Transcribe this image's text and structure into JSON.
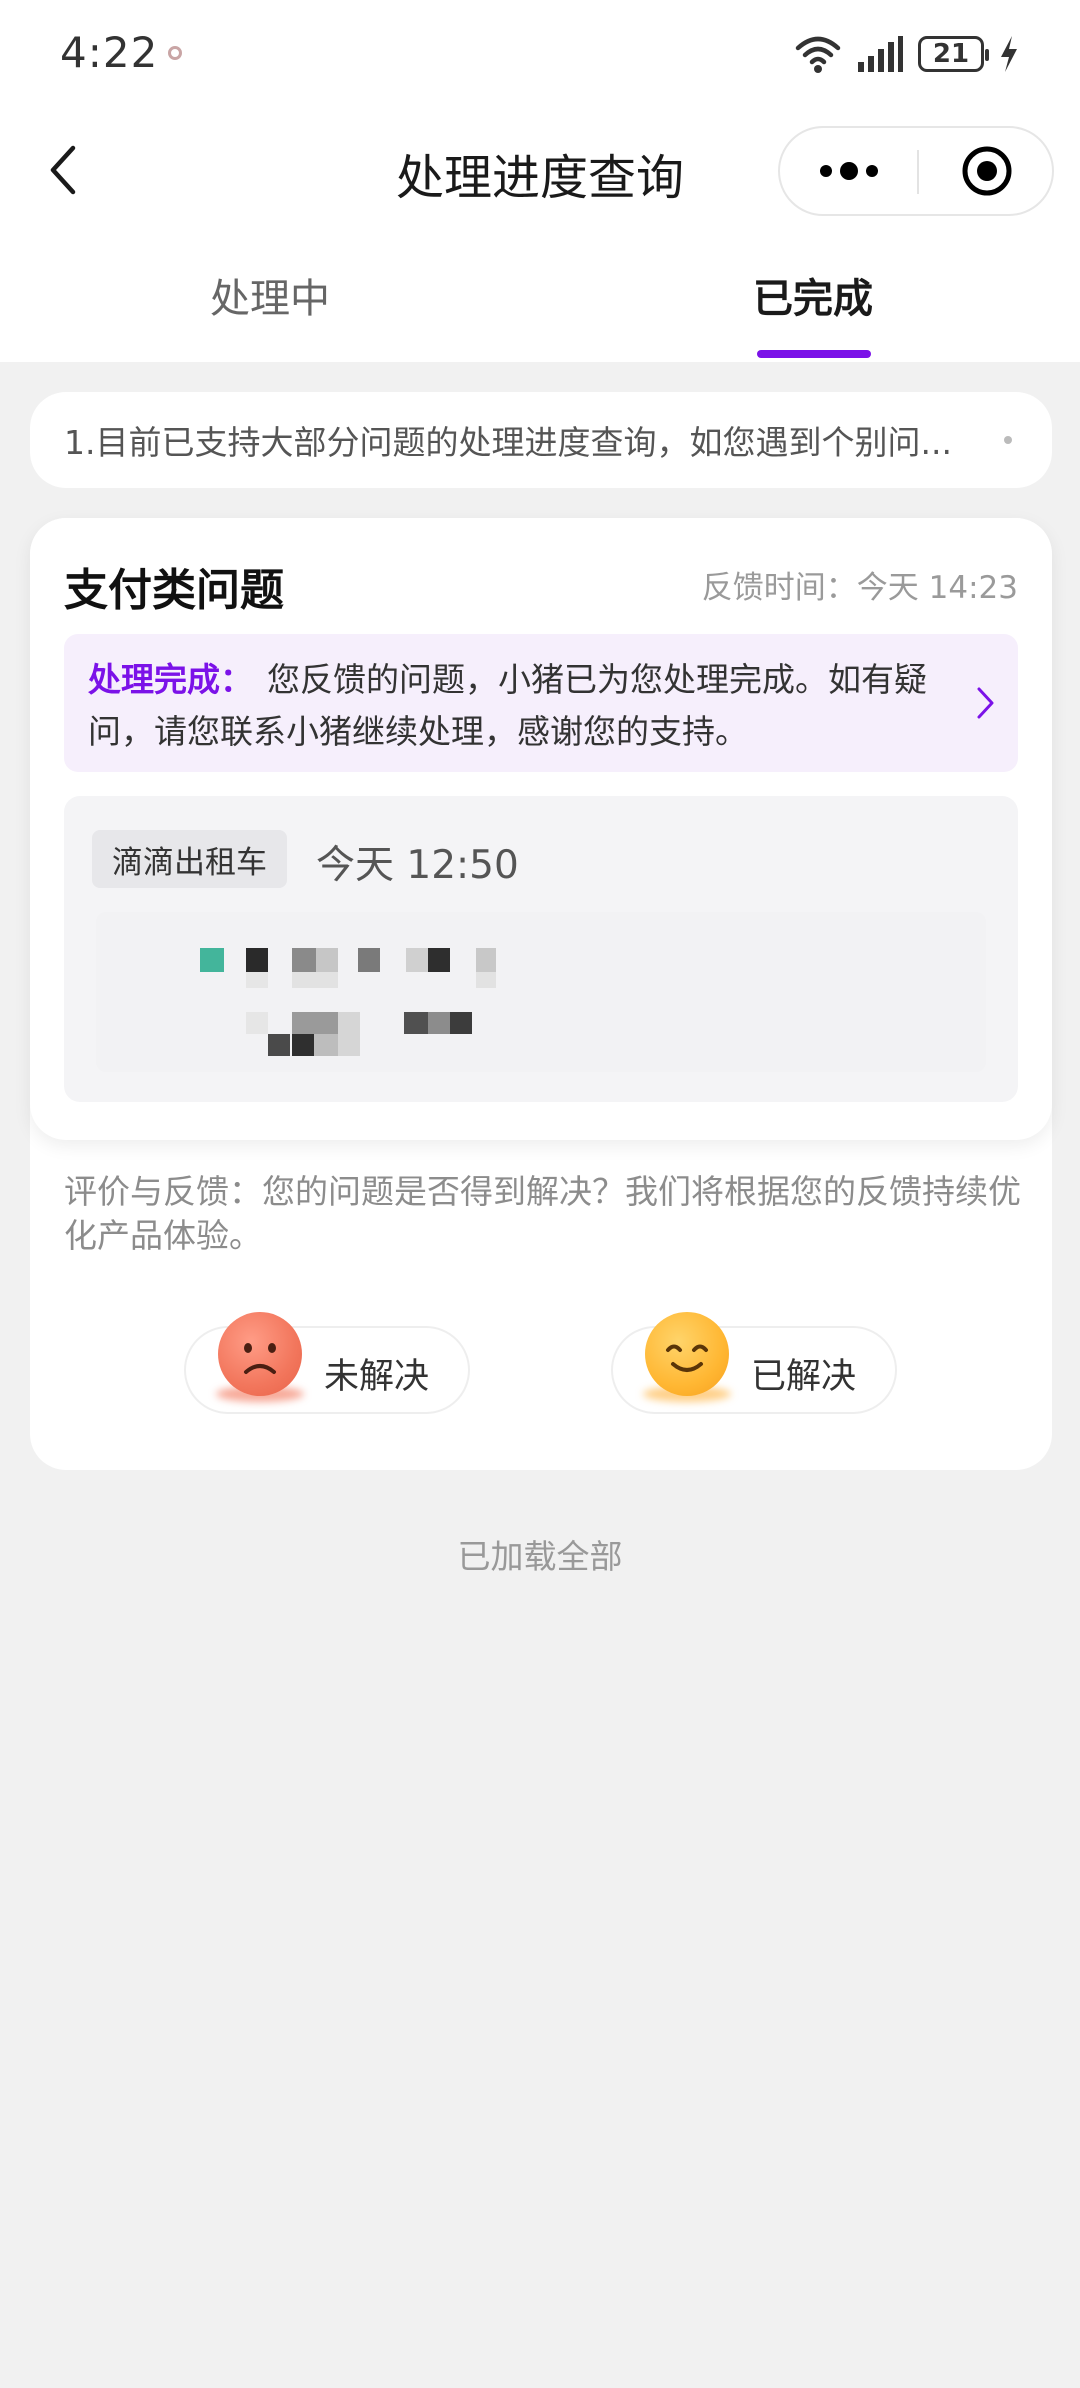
{
  "status_bar": {
    "time": "4:22",
    "battery": "21"
  },
  "nav": {
    "title": "处理进度查询",
    "back_icon": "chevron-left-icon"
  },
  "tabs": [
    {
      "label": "处理中",
      "active": false
    },
    {
      "label": "已完成",
      "active": true
    }
  ],
  "notice": {
    "text": "1.目前已支持大部分问题的处理进度查询，如您遇到个别问..."
  },
  "card": {
    "title": "支付类问题",
    "feedback_time": "反馈时间：今天 14:23",
    "result_label": "处理完成：",
    "result_text": "您反馈的问题，小猪已为您处理完成。如有疑问，请您联系小猪继续处理，感谢您的支持。",
    "service": "滴滴出租车",
    "order_time": "今天 12:50",
    "rating_tip": "评价与反馈：您的问题是否得到解决？我们将根据您的反馈持续优化产品体验。",
    "unresolved_label": "未解决",
    "resolved_label": "已解决"
  },
  "footer": {
    "loaded_all": "已加载全部"
  },
  "colors": {
    "accent": "#7b12e8",
    "background": "#f1f1f1",
    "result_bg": "#f6effc"
  }
}
